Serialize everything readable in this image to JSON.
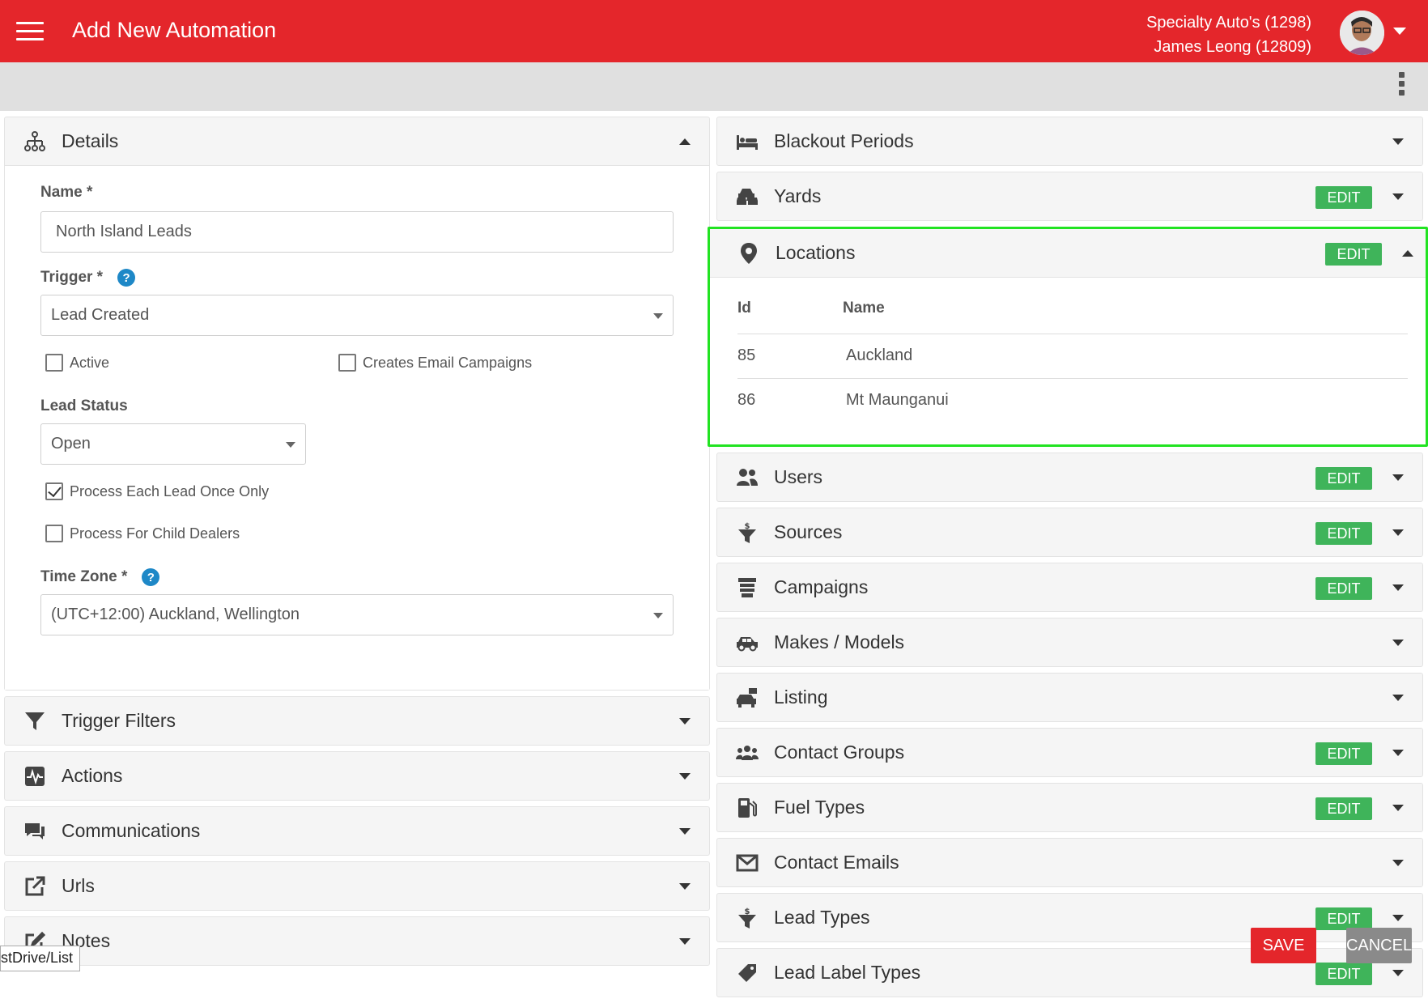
{
  "header": {
    "title": "Add New Automation",
    "dealer": "Specialty Auto's (1298)",
    "user": "James Leong (12809)"
  },
  "details": {
    "title": "Details",
    "name_label": "Name *",
    "name_value": "North Island Leads",
    "trigger_label": "Trigger *",
    "trigger_value": "Lead Created",
    "active_label": "Active",
    "active_checked": false,
    "creates_email_label": "Creates Email Campaigns",
    "creates_email_checked": false,
    "lead_status_label": "Lead Status",
    "lead_status_value": "Open",
    "process_once_label": "Process Each Lead Once Only",
    "process_once_checked": true,
    "process_child_label": "Process For Child Dealers",
    "process_child_checked": false,
    "timezone_label": "Time Zone *",
    "timezone_value": "(UTC+12:00) Auckland, Wellington",
    "help_glyph": "?"
  },
  "left_panels": [
    {
      "title": "Trigger Filters",
      "icon": "filter-icon"
    },
    {
      "title": "Actions",
      "icon": "pulse-icon"
    },
    {
      "title": "Communications",
      "icon": "comments-icon"
    },
    {
      "title": "Urls",
      "icon": "external-link-icon"
    },
    {
      "title": "Notes",
      "icon": "edit-note-icon"
    }
  ],
  "right_panels": {
    "blackout": {
      "title": "Blackout Periods",
      "icon": "bed-icon"
    },
    "yards": {
      "title": "Yards",
      "icon": "cars-icon",
      "edit": "EDIT"
    },
    "locations": {
      "title": "Locations",
      "icon": "map-marker-icon",
      "edit": "EDIT",
      "columns": [
        "Id",
        "Name"
      ],
      "rows": [
        {
          "id": "85",
          "name": "Auckland"
        },
        {
          "id": "86",
          "name": "Mt Maunganui"
        }
      ]
    },
    "users": {
      "title": "Users",
      "icon": "users-icon",
      "edit": "EDIT"
    },
    "sources": {
      "title": "Sources",
      "icon": "funnel-dollar-icon",
      "edit": "EDIT"
    },
    "campaigns": {
      "title": "Campaigns",
      "icon": "layer-stack-icon",
      "edit": "EDIT"
    },
    "makes": {
      "title": "Makes / Models",
      "icon": "car-side-icon"
    },
    "listing": {
      "title": "Listing",
      "icon": "car-listing-icon"
    },
    "contact_groups": {
      "title": "Contact Groups",
      "icon": "group-icon",
      "edit": "EDIT"
    },
    "fuel": {
      "title": "Fuel Types",
      "icon": "gas-pump-icon",
      "edit": "EDIT"
    },
    "contact_emails": {
      "title": "Contact Emails",
      "icon": "envelope-icon"
    },
    "lead_types": {
      "title": "Lead Types",
      "icon": "funnel-dollar-icon",
      "edit": "EDIT"
    },
    "lead_label": {
      "title": "Lead Label Types",
      "icon": "tag-icon",
      "edit": "EDIT"
    }
  },
  "footer": {
    "save": "SAVE",
    "cancel": "CANCEL",
    "status_url": "stDrive/List"
  },
  "colors": {
    "brand_red": "#e4262b",
    "edit_green": "#3fb45a",
    "highlight_green": "#22e322",
    "help_blue": "#1e88c7"
  }
}
